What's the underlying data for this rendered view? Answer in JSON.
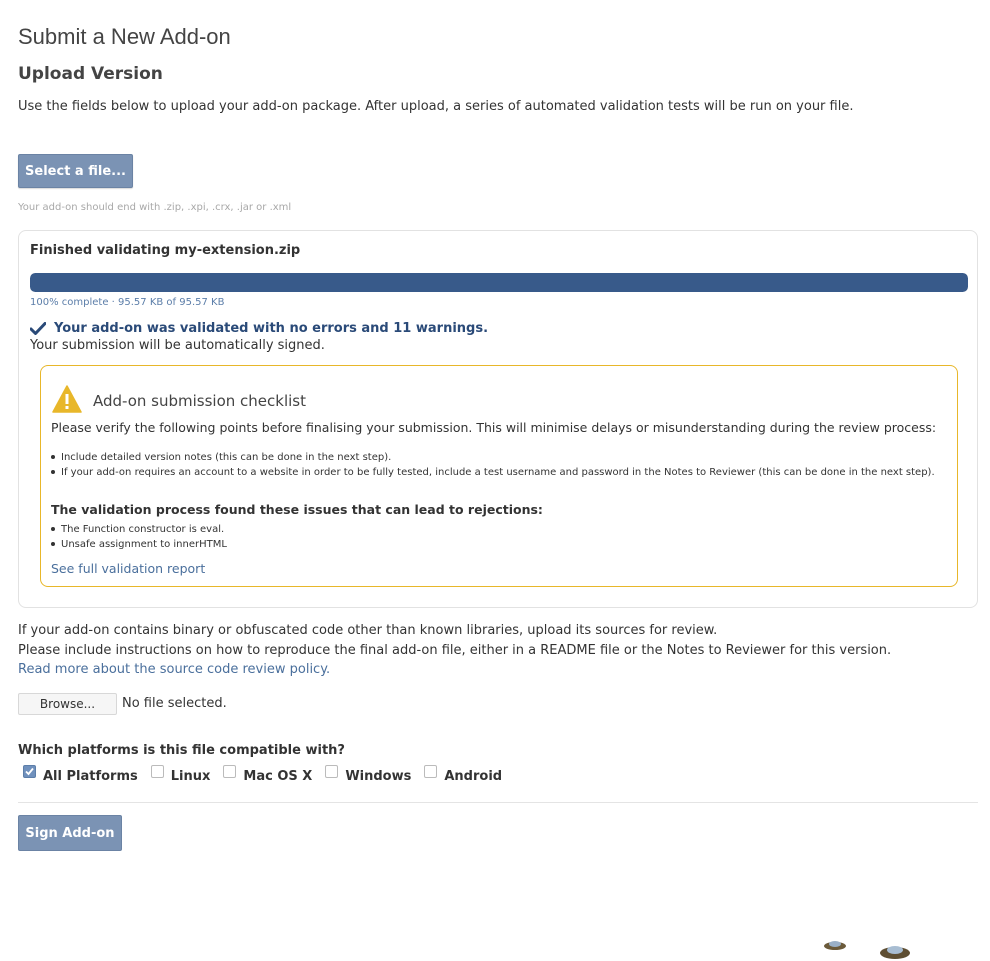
{
  "page": {
    "title": "Submit a New Add-on",
    "section_title": "Upload Version",
    "intro": "Use the fields below to upload your add-on package. After upload, a series of automated validation tests will be run on your file."
  },
  "upload": {
    "select_label": "Select a file...",
    "hint": "Your add-on should end with .zip, .xpi, .crx, .jar or .xml"
  },
  "validation": {
    "title": "Finished validating my-extension.zip",
    "progress_fraction": 1.0,
    "progress_text": "100% complete · 95.57 KB of 95.57 KB",
    "result": "Your add-on was validated with no errors and 11 warnings.",
    "signed_note": "Your submission will be automatically signed."
  },
  "checklist": {
    "title": "Add-on submission checklist",
    "intro": "Please verify the following points before finalising your submission. This will minimise delays or misunderstanding during the review process:",
    "items": [
      "Include detailed version notes (this can be done in the next step).",
      "If your add-on requires an account to a website in order to be fully tested, include a test username and password in the Notes to Reviewer (this can be done in the next step)."
    ],
    "issues_title": "The validation process found these issues that can lead to rejections:",
    "issues": [
      "The Function constructor is eval.",
      "Unsafe assignment to innerHTML"
    ],
    "report_link": "See full validation report"
  },
  "source": {
    "line1": "If your add-on contains binary or obfuscated code other than known libraries, upload its sources for review.",
    "line2": "Please include instructions on how to reproduce the final add-on file, either in a README file or the Notes to Reviewer for this version.",
    "policy_link": "Read more about the source code review policy.",
    "browse_label": "Browse...",
    "no_file": "No file selected."
  },
  "platforms": {
    "question": "Which platforms is this file compatible with?",
    "options": [
      {
        "label": "All Platforms",
        "checked": true
      },
      {
        "label": "Linux",
        "checked": false
      },
      {
        "label": "Mac OS X",
        "checked": false
      },
      {
        "label": "Windows",
        "checked": false
      },
      {
        "label": "Android",
        "checked": false
      }
    ]
  },
  "actions": {
    "sign_label": "Sign Add-on"
  },
  "colors": {
    "button": "#7b93b4",
    "progress": "#385a8a",
    "warning_border": "#e8b72a",
    "link": "#4a6f9c"
  }
}
